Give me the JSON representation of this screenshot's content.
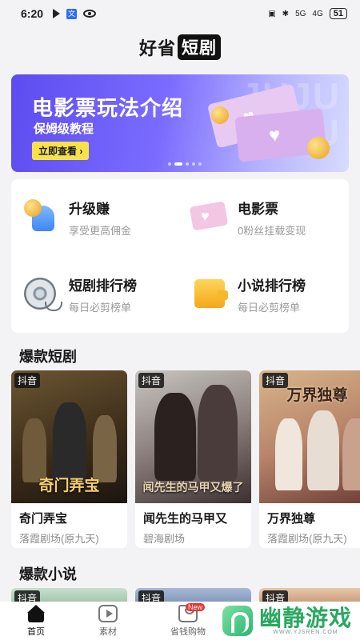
{
  "status_bar": {
    "time": "6:20",
    "translate_glyph": "文",
    "battery": "51",
    "network": "5G",
    "signal": "4G"
  },
  "header": {
    "title_part1": "好省",
    "title_part2": "短剧"
  },
  "banner": {
    "title": "电影票玩法介绍",
    "subtitle": "保姆级教程",
    "cta": "立即查看 ›",
    "bg_text": "JUJU\nJUJU",
    "active_dot": 1
  },
  "features": [
    {
      "title": "升级赚",
      "desc": "享受更高佣金",
      "icon": "thumbs-up-coin-icon"
    },
    {
      "title": "电影票",
      "desc": "0粉丝挂载变现",
      "icon": "movie-ticket-icon"
    },
    {
      "title": "短剧排行榜",
      "desc": "每日必剪榜单",
      "icon": "film-reel-icon"
    },
    {
      "title": "小说排行榜",
      "desc": "每日必剪榜单",
      "icon": "wallet-book-icon"
    }
  ],
  "sections": {
    "dramas_title": "爆款短剧",
    "novels_title": "爆款小说"
  },
  "dramas": [
    {
      "platform": "抖音",
      "poster_text": "奇门弄宝",
      "name": "奇门弄宝",
      "studio": "落霞剧场(原九天)"
    },
    {
      "platform": "抖音",
      "poster_text": "闻先生的马甲又爆了",
      "name": "闻先生的马甲又",
      "studio": "碧海剧场"
    },
    {
      "platform": "抖音",
      "poster_text": "万界独尊",
      "name": "万界独尊",
      "studio": "落霞剧场(原九天)"
    }
  ],
  "novels": [
    {
      "platform": "抖音"
    },
    {
      "platform": "抖音"
    },
    {
      "platform": "抖音"
    }
  ],
  "nav": {
    "home": "首页",
    "materials": "素材",
    "shop": "省钱购物",
    "shop_badge": "New"
  },
  "watermark": {
    "text": "幽静游戏",
    "url": "WWW.YJSREN.COM"
  }
}
